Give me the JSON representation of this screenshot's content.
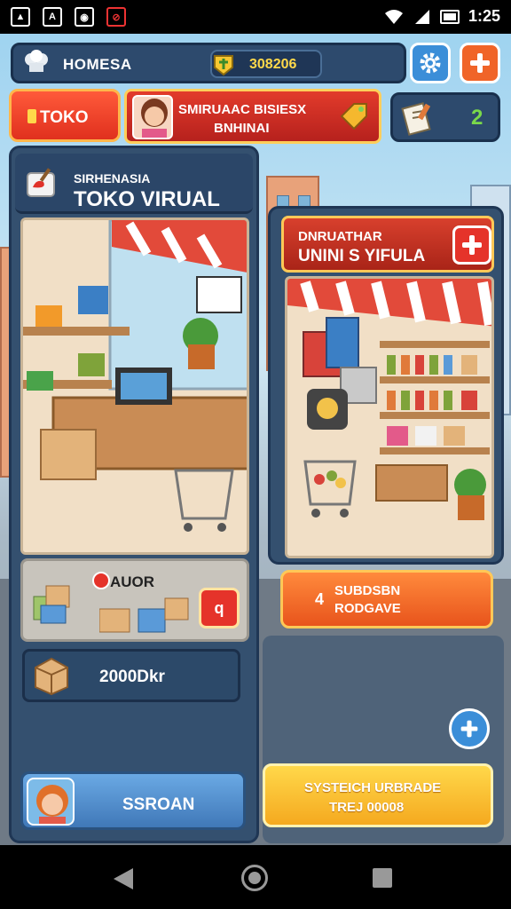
{
  "status_bar": {
    "time": "1:25"
  },
  "top_bar": {
    "title": "HOMESA",
    "coins": "308206"
  },
  "tabs": {
    "toko_label": "TOKO"
  },
  "banner": {
    "line1": "SMIRUAAC BISIESX",
    "line2": "BNHINAI"
  },
  "badge": {
    "count": "2"
  },
  "left_panel": {
    "subtitle": "SIRHENASIA",
    "title": "TOKO VIRUAL",
    "item_label": "AUOR",
    "item_button": "q",
    "stock_value": "2000Dkr",
    "person_button": "SSROAN"
  },
  "right_panel": {
    "header_line1": "DNRUATHAR",
    "header_line2": "UNINI S YIFULA",
    "orange_number": "4",
    "orange_line1": "SUBDSBN",
    "orange_line2": "RODGAVE",
    "yellow_line1": "SYSTEICH URBRADE",
    "yellow_line2": "TREJ 00008"
  },
  "colors": {
    "panel": "#34506f",
    "accent_red": "#e5332a",
    "accent_orange": "#f06428",
    "accent_blue": "#3b8ed8",
    "accent_yellow": "#ffd84a"
  },
  "icons": [
    "chef-hat-icon",
    "coin-icon",
    "gear-icon",
    "plus-icon",
    "tag-icon",
    "scroll-icon",
    "shop-icon",
    "box-icon",
    "back-icon",
    "home-icon",
    "recent-icon"
  ]
}
